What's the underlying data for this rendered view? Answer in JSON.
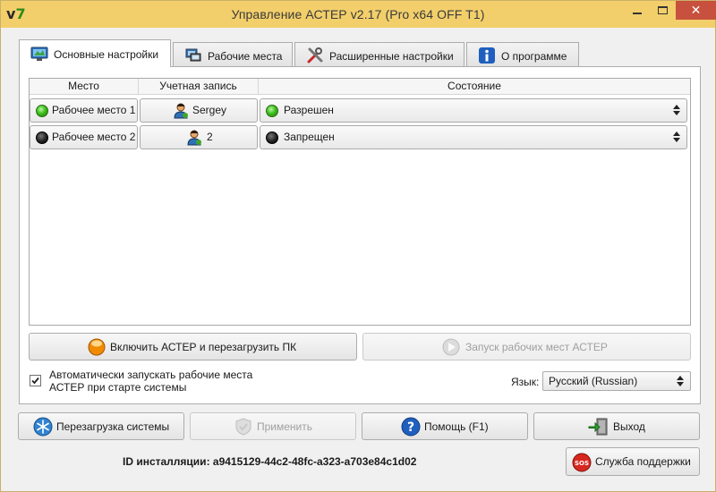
{
  "window": {
    "title": "Управление АСТЕР v2.17 (Pro x64 OFF T1)",
    "close_symbol": "✕"
  },
  "tabs": [
    {
      "label": "Основные настройки",
      "icon": "settings-monitor-icon",
      "active": true
    },
    {
      "label": "Рабочие места",
      "icon": "workstations-icon",
      "active": false
    },
    {
      "label": "Расширенные настройки",
      "icon": "tools-icon",
      "active": false
    },
    {
      "label": "О программе",
      "icon": "info-icon",
      "active": false
    }
  ],
  "grid": {
    "columns": [
      "Место",
      "Учетная запись",
      "Состояние"
    ],
    "rows": [
      {
        "place": "Рабочее место 1",
        "place_status": "green",
        "account": "Sergey",
        "state": "Разрешен",
        "state_status": "green"
      },
      {
        "place": "Рабочее место 2",
        "place_status": "black",
        "account": "2",
        "state": "Запрещен",
        "state_status": "black"
      }
    ]
  },
  "actions": {
    "enable_restart": "Включить АСТЕР и перезагрузить ПК",
    "launch_workstations": "Запуск рабочих мест АСТЕР"
  },
  "autostart": {
    "checked": true,
    "label": "Автоматически запускать  рабочие места АСТЕР при старте системы"
  },
  "language": {
    "label": "Язык:",
    "value": "Русский (Russian)"
  },
  "footer": {
    "restart_system": "Перезагрузка системы",
    "apply": "Применить",
    "help": "Помощь (F1)",
    "exit": "Выход",
    "install_id": "ID инсталляции: a9415129-44c2-48fc-a323-a703e84c1d02",
    "support": "Служба поддержки"
  },
  "colors": {
    "titlebar": "#f2cf6b",
    "close_button": "#c7503e",
    "status_green": "#3fbf1d",
    "status_black": "#222222"
  }
}
